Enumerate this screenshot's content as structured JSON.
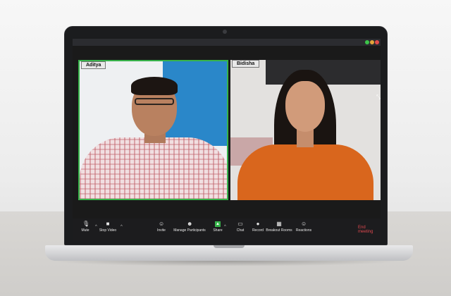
{
  "participants": [
    {
      "name": "Aditya"
    },
    {
      "name": "Bidisha"
    }
  ],
  "toolbar": {
    "mute": "Mute",
    "stop_video": "Stop Video",
    "invite": "Invite",
    "manage_participants": "Manage Participants",
    "share": "Share",
    "chat": "Chat",
    "record": "Record",
    "breakout_rooms": "Breakout Rooms",
    "reactions": "Reactions",
    "end_meeting": "End meeting"
  },
  "colors": {
    "active_speaker_border": "#37b34a",
    "end_meeting": "#e0484f",
    "share_icon": "#37b34a"
  },
  "icons": {
    "mute": "microphone-icon",
    "stop_video": "video-camera-icon",
    "invite": "add-person-icon",
    "manage_participants": "participants-icon",
    "share": "share-screen-icon",
    "chat": "chat-bubble-icon",
    "record": "record-icon",
    "breakout_rooms": "grid-icon",
    "reactions": "emoji-icon",
    "expand": "expand-icon"
  }
}
